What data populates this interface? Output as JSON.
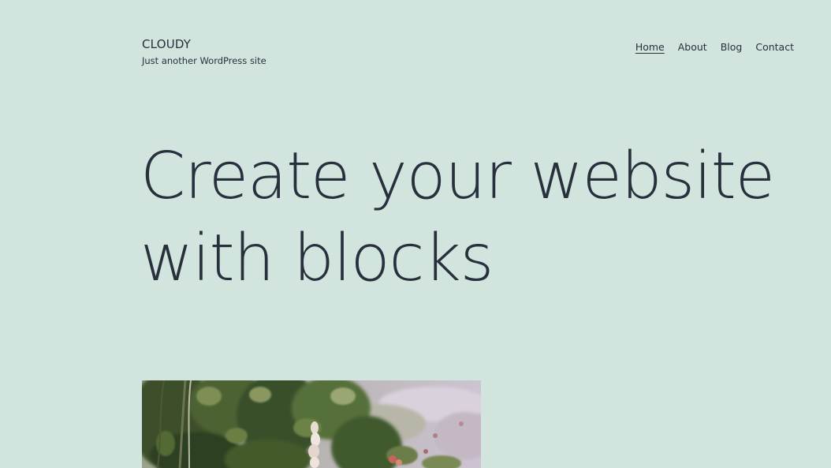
{
  "site": {
    "title": "CLOUDY",
    "tagline": "Just another WordPress site"
  },
  "nav": {
    "items": [
      {
        "label": "Home",
        "current": true
      },
      {
        "label": "About",
        "current": false
      },
      {
        "label": "Blog",
        "current": false
      },
      {
        "label": "Contact",
        "current": false
      }
    ]
  },
  "hero": {
    "line1": "Create your website",
    "line2": "with blocks"
  },
  "colors": {
    "background": "#d1e4dd",
    "text": "#28303d"
  }
}
